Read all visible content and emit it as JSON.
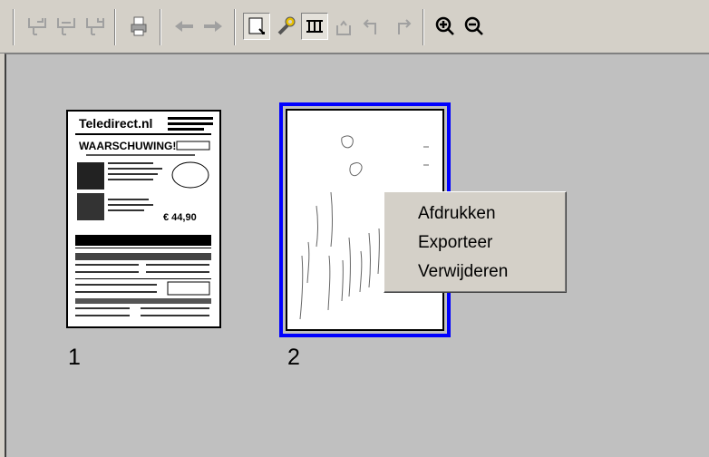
{
  "toolbar": {
    "buttons": [
      {
        "name": "scan-insert-icon"
      },
      {
        "name": "scan-replace-icon"
      },
      {
        "name": "scan-append-icon"
      },
      {
        "name": "print-icon"
      },
      {
        "name": "arrow-left-icon"
      },
      {
        "name": "arrow-right-icon"
      },
      {
        "name": "thumbnail-view-icon",
        "active": true
      },
      {
        "name": "settings-wrench-icon"
      },
      {
        "name": "grid-view-icon",
        "active": true
      },
      {
        "name": "rotate-icon"
      },
      {
        "name": "rotate-left-icon"
      },
      {
        "name": "rotate-right-icon"
      },
      {
        "name": "zoom-in-icon"
      },
      {
        "name": "zoom-out-icon"
      }
    ]
  },
  "pages": [
    {
      "label": "1",
      "header_text": "Teledirect.nl",
      "warning_text": "WAARSCHUWING!",
      "price_text": "€ 44,90"
    },
    {
      "label": "2"
    }
  ],
  "context_menu": {
    "items": [
      "Afdrukken",
      "Exporteer",
      "Verwijderen"
    ]
  },
  "colors": {
    "selection": "#0000ff",
    "background": "#c0c0c0",
    "toolbar": "#d4d0c8"
  }
}
